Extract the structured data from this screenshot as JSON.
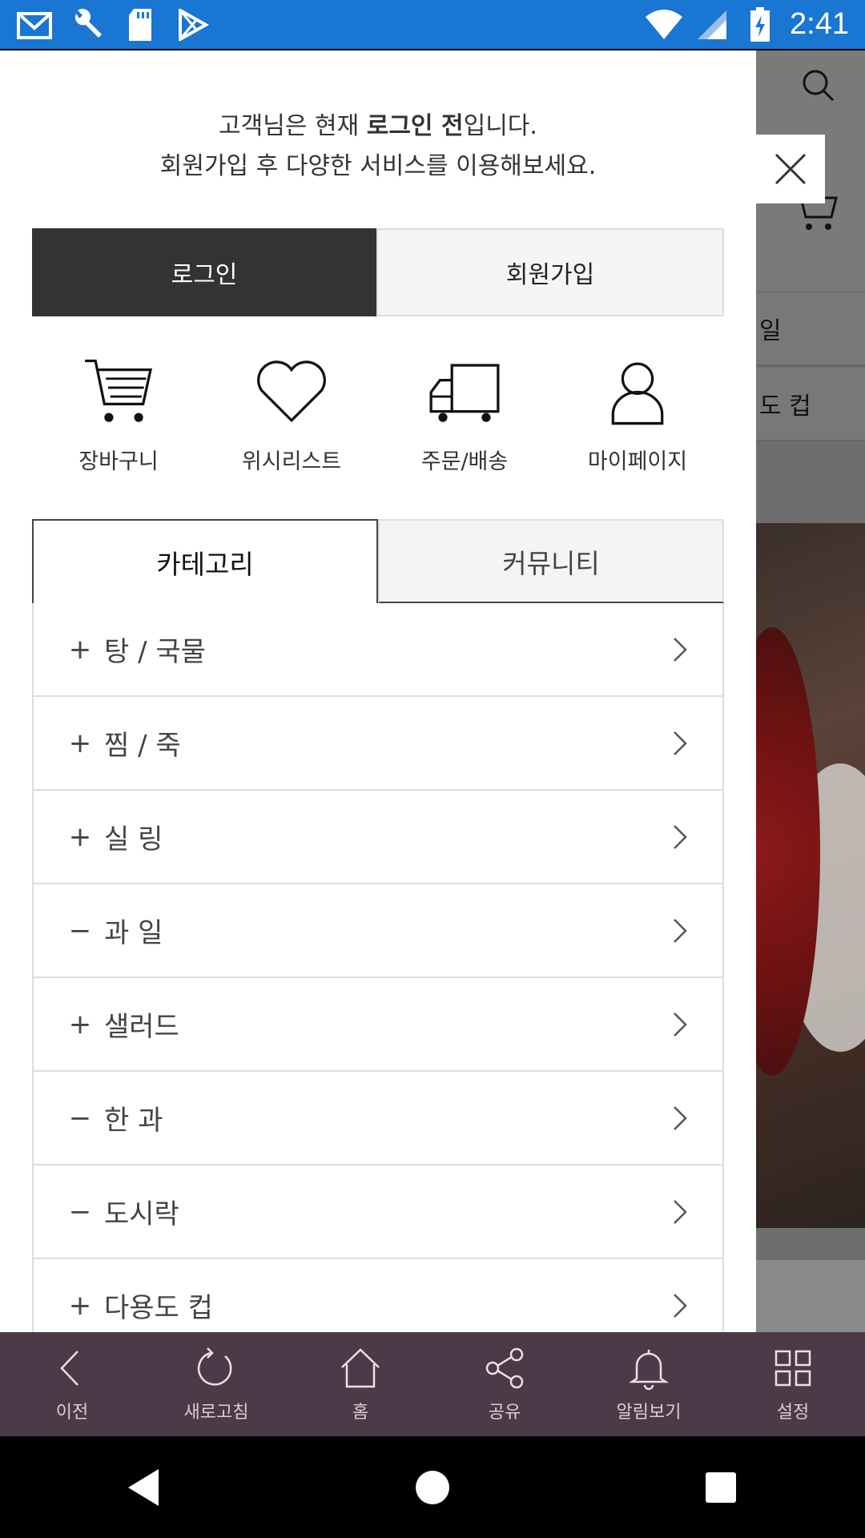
{
  "status_bar": {
    "time": "2:41",
    "icons": [
      "gmail-icon",
      "wrench-icon",
      "sd-card-icon",
      "play-store-icon",
      "wifi-icon",
      "signal-icon",
      "battery-charging-icon"
    ]
  },
  "drawer": {
    "notice_line1_prefix": "고객님은 현재 ",
    "notice_line1_bold": "로그인 전",
    "notice_line1_suffix": "입니다.",
    "notice_line2": "회원가입 후 다양한 서비스를 이용해보세요.",
    "login_label": "로그인",
    "join_label": "회원가입",
    "quick_links": [
      {
        "label": "장바구니",
        "icon": "cart-icon"
      },
      {
        "label": "위시리스트",
        "icon": "heart-icon"
      },
      {
        "label": "주문/배송",
        "icon": "truck-icon"
      },
      {
        "label": "마이페이지",
        "icon": "person-icon"
      }
    ],
    "tabs": [
      {
        "label": "카테고리",
        "active": true
      },
      {
        "label": "커뮤니티",
        "active": false
      }
    ],
    "categories": [
      {
        "sign": "+",
        "name": "탕 / 국물"
      },
      {
        "sign": "+",
        "name": "찜 / 죽"
      },
      {
        "sign": "+",
        "name": "실 링"
      },
      {
        "sign": "−",
        "name": "과 일"
      },
      {
        "sign": "+",
        "name": "샐러드"
      },
      {
        "sign": "−",
        "name": "한 과"
      },
      {
        "sign": "−",
        "name": "도시락"
      },
      {
        "sign": "+",
        "name": "다용도 컵"
      }
    ]
  },
  "background_page": {
    "row1": "일",
    "row2": "도 컵"
  },
  "bottom_bar": [
    {
      "label": "이전",
      "icon": "back-icon"
    },
    {
      "label": "새로고침",
      "icon": "refresh-icon"
    },
    {
      "label": "홈",
      "icon": "home-icon"
    },
    {
      "label": "공유",
      "icon": "share-icon"
    },
    {
      "label": "알림보기",
      "icon": "bell-icon"
    },
    {
      "label": "설정",
      "icon": "grid-icon"
    }
  ],
  "colors": {
    "status_bar": "#1976d2",
    "login_button": "#333333",
    "bottom_bar": "#4c3a48"
  }
}
